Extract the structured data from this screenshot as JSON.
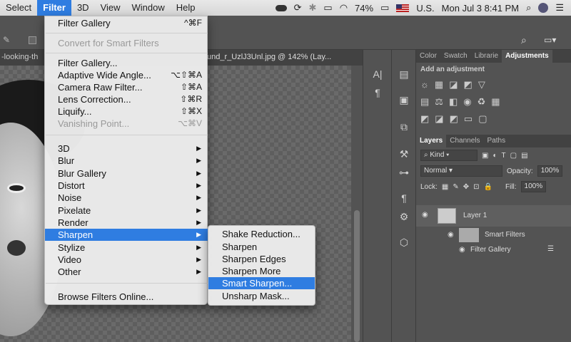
{
  "menubar": {
    "items": [
      "Select",
      "Filter",
      "3D",
      "View",
      "Window",
      "Help"
    ],
    "battery": "74%",
    "input_source": "U.S.",
    "clock": "Mon Jul 3  8:41 PM"
  },
  "document": {
    "tab_left": "-looking-th",
    "tab_right": "und_r_UzlJ3Unl.jpg @ 142% (Lay..."
  },
  "filter_menu": {
    "top": [
      {
        "label": "Filter Gallery",
        "shortcut": "^⌘F"
      },
      {
        "label": "Convert for Smart Filters",
        "disabled": true
      }
    ],
    "group2": [
      {
        "label": "Filter Gallery..."
      },
      {
        "label": "Adaptive Wide Angle...",
        "shortcut": "⌥⇧⌘A"
      },
      {
        "label": "Camera Raw Filter...",
        "shortcut": "⇧⌘A"
      },
      {
        "label": "Lens Correction...",
        "shortcut": "⇧⌘R"
      },
      {
        "label": "Liquify...",
        "shortcut": "⇧⌘X"
      },
      {
        "label": "Vanishing Point...",
        "shortcut": "⌥⌘V",
        "disabled": true
      }
    ],
    "group3": [
      "3D",
      "Blur",
      "Blur Gallery",
      "Distort",
      "Noise",
      "Pixelate",
      "Render",
      "Sharpen",
      "Stylize",
      "Video",
      "Other"
    ],
    "bottom": "Browse Filters Online..."
  },
  "sharpen_submenu": [
    "Shake Reduction...",
    "Sharpen",
    "Sharpen Edges",
    "Sharpen More",
    "Smart Sharpen...",
    "Unsharp Mask..."
  ],
  "panel": {
    "top_tabs": [
      "Color",
      "Swatch",
      "Librarie",
      "Adjustments"
    ],
    "adjust_hint": "Add an adjustment",
    "layer_tabs": [
      "Layers",
      "Channels",
      "Paths"
    ],
    "kind": "Kind",
    "blend_mode": "Normal",
    "opacity_label": "Opacity:",
    "opacity": "100%",
    "lock_label": "Lock:",
    "fill_label": "Fill:",
    "fill": "100%",
    "layer_name": "Layer 1",
    "smart_filters": "Smart Filters",
    "filter_gallery": "Filter Gallery"
  }
}
